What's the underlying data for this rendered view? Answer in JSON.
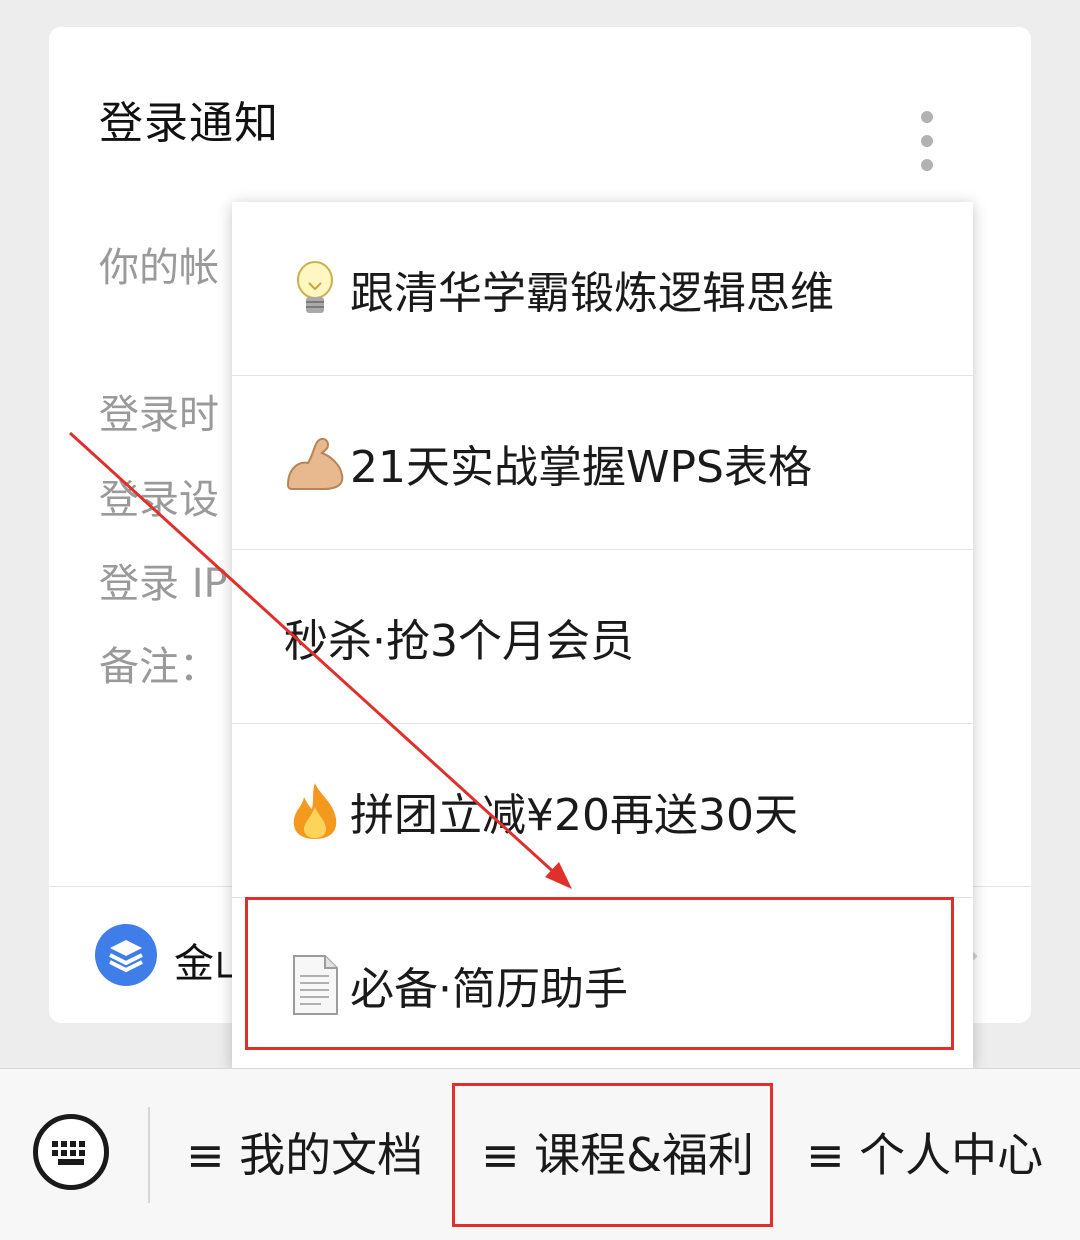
{
  "card": {
    "title": "登录通知",
    "lines": [
      "你的帐",
      "登录时",
      "登录设",
      "登录 IP",
      "备注："
    ],
    "footer_app_name": "金山"
  },
  "menu": {
    "items": [
      {
        "icon": "lightbulb-icon",
        "label": "跟清华学霸锻炼逻辑思维"
      },
      {
        "icon": "flexed-biceps-icon",
        "label": "21天实战掌握WPS表格"
      },
      {
        "icon": "",
        "label": "秒杀·抢3个月会员"
      },
      {
        "icon": "fire-icon",
        "label": "拼团立减¥20再送30天"
      },
      {
        "icon": "document-icon",
        "label": "必备·简历助手"
      }
    ]
  },
  "bottom_bar": {
    "tabs": [
      {
        "label": "≡ 我的文档"
      },
      {
        "label": "≡ 课程&福利"
      },
      {
        "label": "≡ 个人中心"
      }
    ]
  },
  "colors": {
    "annotation_red": "#e0302c",
    "app_logo_blue": "#3f7ee8"
  }
}
